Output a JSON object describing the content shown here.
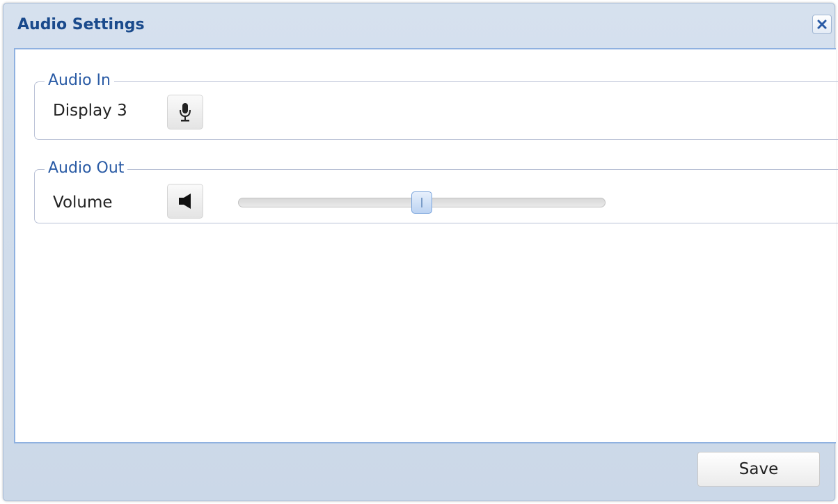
{
  "dialog": {
    "title": "Audio Settings",
    "close_icon": "close-icon"
  },
  "audio_in": {
    "legend": "Audio In",
    "device_label": "Display 3",
    "icon": "microphone-icon"
  },
  "audio_out": {
    "legend": "Audio Out",
    "volume_label": "Volume",
    "icon": "speaker-icon",
    "volume_level": 0.5
  },
  "footer": {
    "save_label": "Save"
  },
  "colors": {
    "title": "#1a4a8c",
    "legend": "#2a5ba5",
    "dialog_bg": "#d6e1ee",
    "content_border": "#8fb1e0",
    "slider_handle": "#bcd3f2"
  }
}
